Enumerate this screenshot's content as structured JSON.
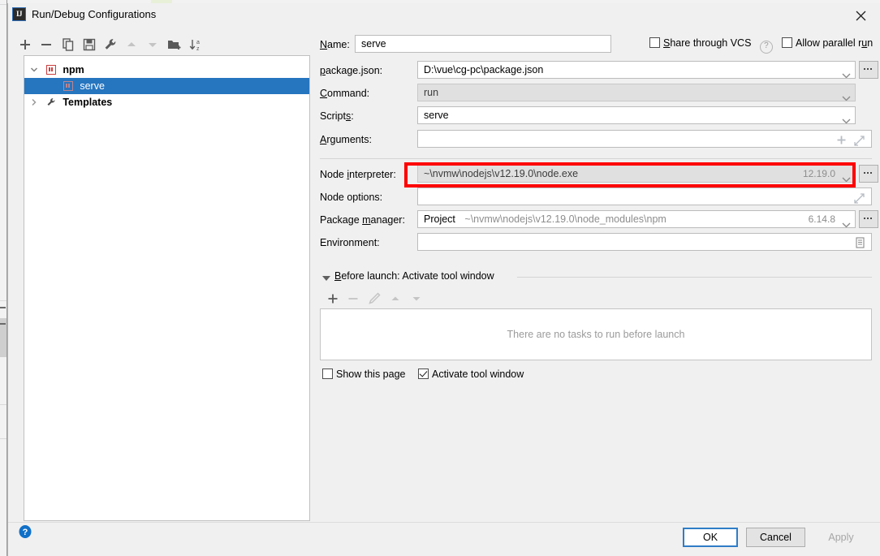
{
  "window": {
    "title": "Run/Debug Configurations",
    "app_icon": "IJ",
    "close_icon": "close-icon"
  },
  "toolbar": {
    "items": [
      {
        "name": "add-configuration-button",
        "icon": "plus-icon",
        "label": "+",
        "enabled": true
      },
      {
        "name": "remove-configuration-button",
        "icon": "minus-icon",
        "label": "−",
        "enabled": true
      },
      {
        "name": "copy-configuration-button",
        "icon": "copy-icon",
        "label": "Copy",
        "enabled": true
      },
      {
        "name": "save-configuration-button",
        "icon": "save-icon",
        "label": "Save",
        "enabled": true
      },
      {
        "name": "edit-templates-button",
        "icon": "wrench-icon",
        "label": "Edit Templates",
        "enabled": true
      },
      {
        "name": "move-up-button",
        "icon": "arrow-up-icon",
        "label": "Move Up",
        "enabled": false
      },
      {
        "name": "move-down-button",
        "icon": "arrow-down-icon",
        "label": "Move Down",
        "enabled": false
      },
      {
        "name": "new-folder-button",
        "icon": "folder-add-icon",
        "label": "New Folder",
        "enabled": true
      },
      {
        "name": "sort-configurations-button",
        "icon": "sort-alpha-icon",
        "label": "Sort Configurations",
        "enabled": true
      }
    ]
  },
  "tree": {
    "nodes": [
      {
        "label": "npm",
        "icon": "npm-icon",
        "expanded": true,
        "bold": true,
        "selected": false,
        "depth": 0
      },
      {
        "label": "serve",
        "icon": "npm-icon",
        "expanded": null,
        "bold": false,
        "selected": true,
        "depth": 1
      },
      {
        "label": "Templates",
        "icon": "wrench-icon",
        "expanded": false,
        "bold": true,
        "selected": false,
        "depth": 0
      }
    ]
  },
  "form": {
    "name": {
      "label": "Name:",
      "label_mnemonic": "N",
      "value": "serve"
    },
    "share_through_vcs": {
      "label": "Share through VCS",
      "label_mnemonic": "S",
      "checked": false,
      "help_icon": "question-mark-icon"
    },
    "allow_parallel_run": {
      "label": "Allow parallel run",
      "label_mnemonic": "u",
      "checked": false
    },
    "package_json": {
      "label": "package.json:",
      "label_mnemonic": "p",
      "value": "D:\\vue\\cg-pc\\package.json",
      "disabled": false,
      "has_dropdown": true,
      "has_browse": true
    },
    "command": {
      "label": "Command:",
      "label_mnemonic": "C",
      "value": "run",
      "disabled": true,
      "has_dropdown": true,
      "has_browse": false
    },
    "scripts": {
      "label": "Scripts:",
      "label_mnemonic": "s",
      "value": "serve",
      "disabled": false,
      "has_dropdown": true,
      "has_browse": false
    },
    "arguments": {
      "label": "Arguments:",
      "label_mnemonic": "A",
      "value": "",
      "placeholder": "",
      "inner_icons": [
        "plus-icon",
        "expand-icon"
      ]
    },
    "node_interpreter": {
      "label": "Node interpreter:",
      "label_mnemonic": "i",
      "value": "~\\nvmw\\nodejs\\v12.19.0\\node.exe",
      "version": "12.19.0",
      "disabled": true,
      "highlighted": true,
      "highlight_color": "#ff0000",
      "has_dropdown": true,
      "has_browse": true
    },
    "node_options": {
      "label": "Node options:",
      "value": "",
      "inner_icons": [
        "expand-icon"
      ]
    },
    "package_manager": {
      "label": "Package manager:",
      "label_mnemonic": "m",
      "scope": "Project",
      "path": "~\\nvmw\\nodejs\\v12.19.0\\node_modules\\npm",
      "version": "6.14.8",
      "has_dropdown": true,
      "has_browse": true
    },
    "environment": {
      "label": "Environment:",
      "value": "",
      "inner_icons": [
        "list-edit-icon"
      ]
    }
  },
  "before_launch": {
    "title": "Before launch: Activate tool window",
    "title_mnemonic": "B",
    "expanded": true,
    "toolbar": [
      {
        "name": "add-task-button",
        "icon": "plus-icon",
        "enabled": true
      },
      {
        "name": "remove-task-button",
        "icon": "minus-icon",
        "enabled": false
      },
      {
        "name": "edit-task-button",
        "icon": "pencil-icon",
        "enabled": false
      },
      {
        "name": "task-move-up-button",
        "icon": "arrow-up-icon",
        "enabled": false
      },
      {
        "name": "task-move-down-button",
        "icon": "arrow-down-icon",
        "enabled": false
      }
    ],
    "empty_text": "There are no tasks to run before launch",
    "show_this_page": {
      "label": "Show this page",
      "checked": false
    },
    "activate_tool_window": {
      "label": "Activate tool window",
      "checked": true
    }
  },
  "footer": {
    "help_icon": "help-icon",
    "ok_label": "OK",
    "cancel_label": "Cancel",
    "apply_label": "Apply",
    "apply_enabled": false
  },
  "colors": {
    "selection_blue": "#2675bf",
    "highlight_red": "#ff0000",
    "focus_blue": "#2f7dc7",
    "dialog_bg": "#f0f0f0"
  }
}
